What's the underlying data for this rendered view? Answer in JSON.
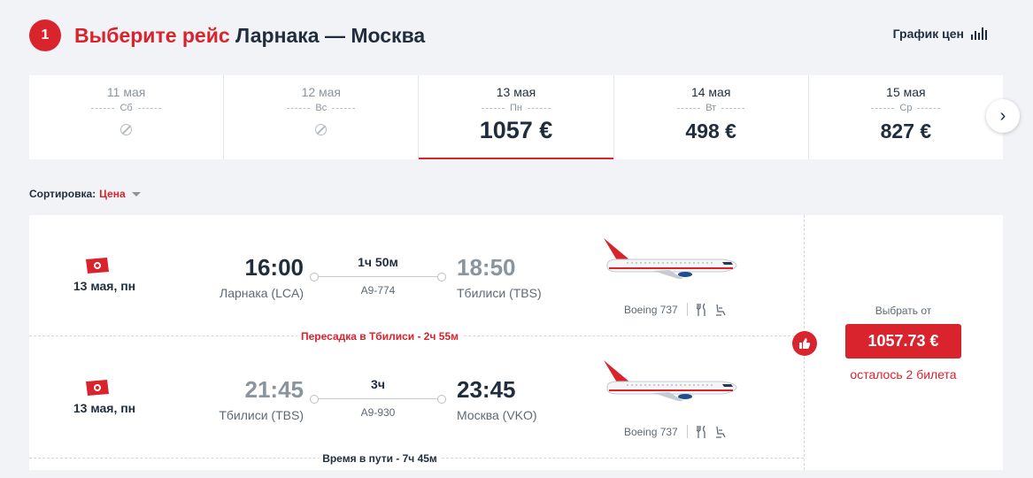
{
  "header": {
    "step": "1",
    "title_red": "Выберите рейс",
    "title_route": "Ларнака — Москва",
    "price_chart": "График цен"
  },
  "dates": [
    {
      "date": "11 мая",
      "dow": "Сб",
      "price": ""
    },
    {
      "date": "12 мая",
      "dow": "Вс",
      "price": ""
    },
    {
      "date": "13 мая",
      "dow": "Пн",
      "price": "1057 €"
    },
    {
      "date": "14 мая",
      "dow": "Вт",
      "price": "498 €"
    },
    {
      "date": "15 мая",
      "dow": "Ср",
      "price": "827 €"
    }
  ],
  "sort": {
    "label": "Сортировка:",
    "value": "Цена"
  },
  "segments": [
    {
      "date": "13 мая, пн",
      "dep_time": "16:00",
      "dep_city": "Ларнака (LCA)",
      "duration": "1ч 50м",
      "flight": "A9-774",
      "arr_time": "18:50",
      "arr_city": "Тбилиси (TBS)",
      "aircraft": "Boeing 737"
    },
    {
      "date": "13 мая, пн",
      "dep_time": "21:45",
      "dep_city": "Тбилиси (TBS)",
      "duration": "3ч",
      "flight": "A9-930",
      "arr_time": "23:45",
      "arr_city": "Москва (VKO)",
      "aircraft": "Boeing 737"
    }
  ],
  "transfer": "Пересадка в Тбилиси - 2ч 55м",
  "total_time": "Время в пути - 7ч 45м",
  "offer": {
    "label": "Выбрать от",
    "price": "1057.73 €",
    "left": "осталось 2 билета"
  },
  "colors": {
    "accent": "#d9232d",
    "text": "#1f2d3d",
    "muted": "#8a949e"
  },
  "icons": [
    "no-flights-icon",
    "bar-chart-icon",
    "chevron-right-icon",
    "airline-logo-icon",
    "meal-icon",
    "seat-icon",
    "thumbs-up-icon"
  ]
}
